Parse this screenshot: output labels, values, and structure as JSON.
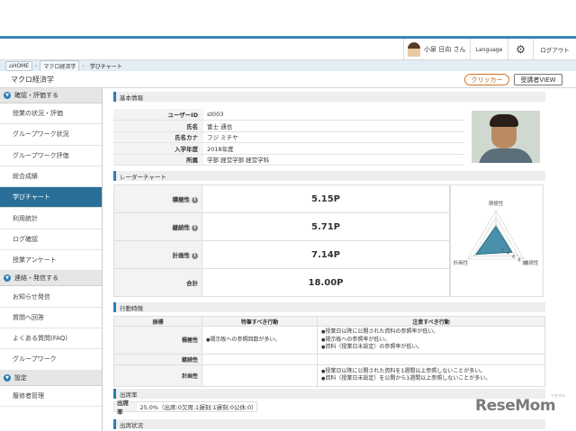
{
  "header": {
    "user_name": "小泉 日向 さん",
    "language": "Language",
    "logout": "ログアウト",
    "gear_glyph": "⚙"
  },
  "breadcrumb": [
    "HOME",
    "マクロ経済学",
    "学びチャート"
  ],
  "course": {
    "title": "マクロ経済学",
    "clicker_button": "クリッカー",
    "view_button": "受講者VIEW"
  },
  "sidebar": {
    "section1": "確認・評価する",
    "items1": [
      "授業の状況・評価",
      "グループワーク状況",
      "グループワーク評価",
      "総合成績",
      "学びチャート",
      "利用統計",
      "ログ確認",
      "授業アンケート"
    ],
    "section2": "連絡・発信する",
    "items2": [
      "お知らせ発信",
      "質問へ回答",
      "よくある質問(FAQ)",
      "グループワーク"
    ],
    "section3": "設定",
    "items3": [
      "履修者管理"
    ]
  },
  "basic": {
    "section": "基本情報",
    "rows": [
      {
        "k": "ユーザーID",
        "v": "st003"
      },
      {
        "k": "氏名",
        "v": "富士 通也"
      },
      {
        "k": "氏名カナ",
        "v": "フジ ミチヤ"
      },
      {
        "k": "入学年度",
        "v": "2018年度"
      },
      {
        "k": "所属",
        "v": "学部 経営学部 経営学科"
      }
    ]
  },
  "radar": {
    "section": "レーダーチャート",
    "rows": [
      {
        "k": "積極性",
        "v": "5.15P"
      },
      {
        "k": "継続性",
        "v": "5.71P"
      },
      {
        "k": "計画性",
        "v": "7.14P"
      },
      {
        "k": "合計",
        "v": "18.00P"
      }
    ],
    "axis": [
      "積極性",
      "継続性",
      "計画性"
    ],
    "ticks": [
      "2",
      "4",
      "6",
      "8",
      "10"
    ]
  },
  "chart_data": {
    "type": "radar",
    "categories": [
      "積極性",
      "継続性",
      "計画性"
    ],
    "values": [
      5.15,
      5.71,
      7.14
    ],
    "ylim": [
      0,
      10
    ],
    "total": 18.0
  },
  "behavior": {
    "section": "行動特徴",
    "col_k": "振標",
    "col_good": "特筆すべき行動",
    "col_bad": "注意すべき行動",
    "rows": [
      {
        "k": "積極性",
        "good": [
          "掲示板への参照回数が多い。"
        ],
        "bad": [
          "授業日以降に公開された資料の参照率が低い。",
          "掲示板への参照率が低い。",
          "資料（授業日未設定）の参照率が低い。"
        ]
      },
      {
        "k": "継続性",
        "good": [],
        "bad": []
      },
      {
        "k": "計画性",
        "good": [],
        "bad": [
          "授業日以降に公開された資料を1週間以上参照しないことが多い。",
          "資料（授業日未設定）を公開から1週間以上参照しないことが多い。"
        ]
      }
    ]
  },
  "attendance": {
    "section": "出席率",
    "label": "出席率",
    "value": "25.0%（出席:0欠席:1遅刻:1遅刻:0公休:0）",
    "status_section": "出席状況"
  },
  "watermark": {
    "main": "ReseMom",
    "sub": "リセマム"
  },
  "colors": {
    "accent": "#2a7fb5",
    "active": "#2a6f98",
    "radar_fill": "#2a7f9e"
  }
}
